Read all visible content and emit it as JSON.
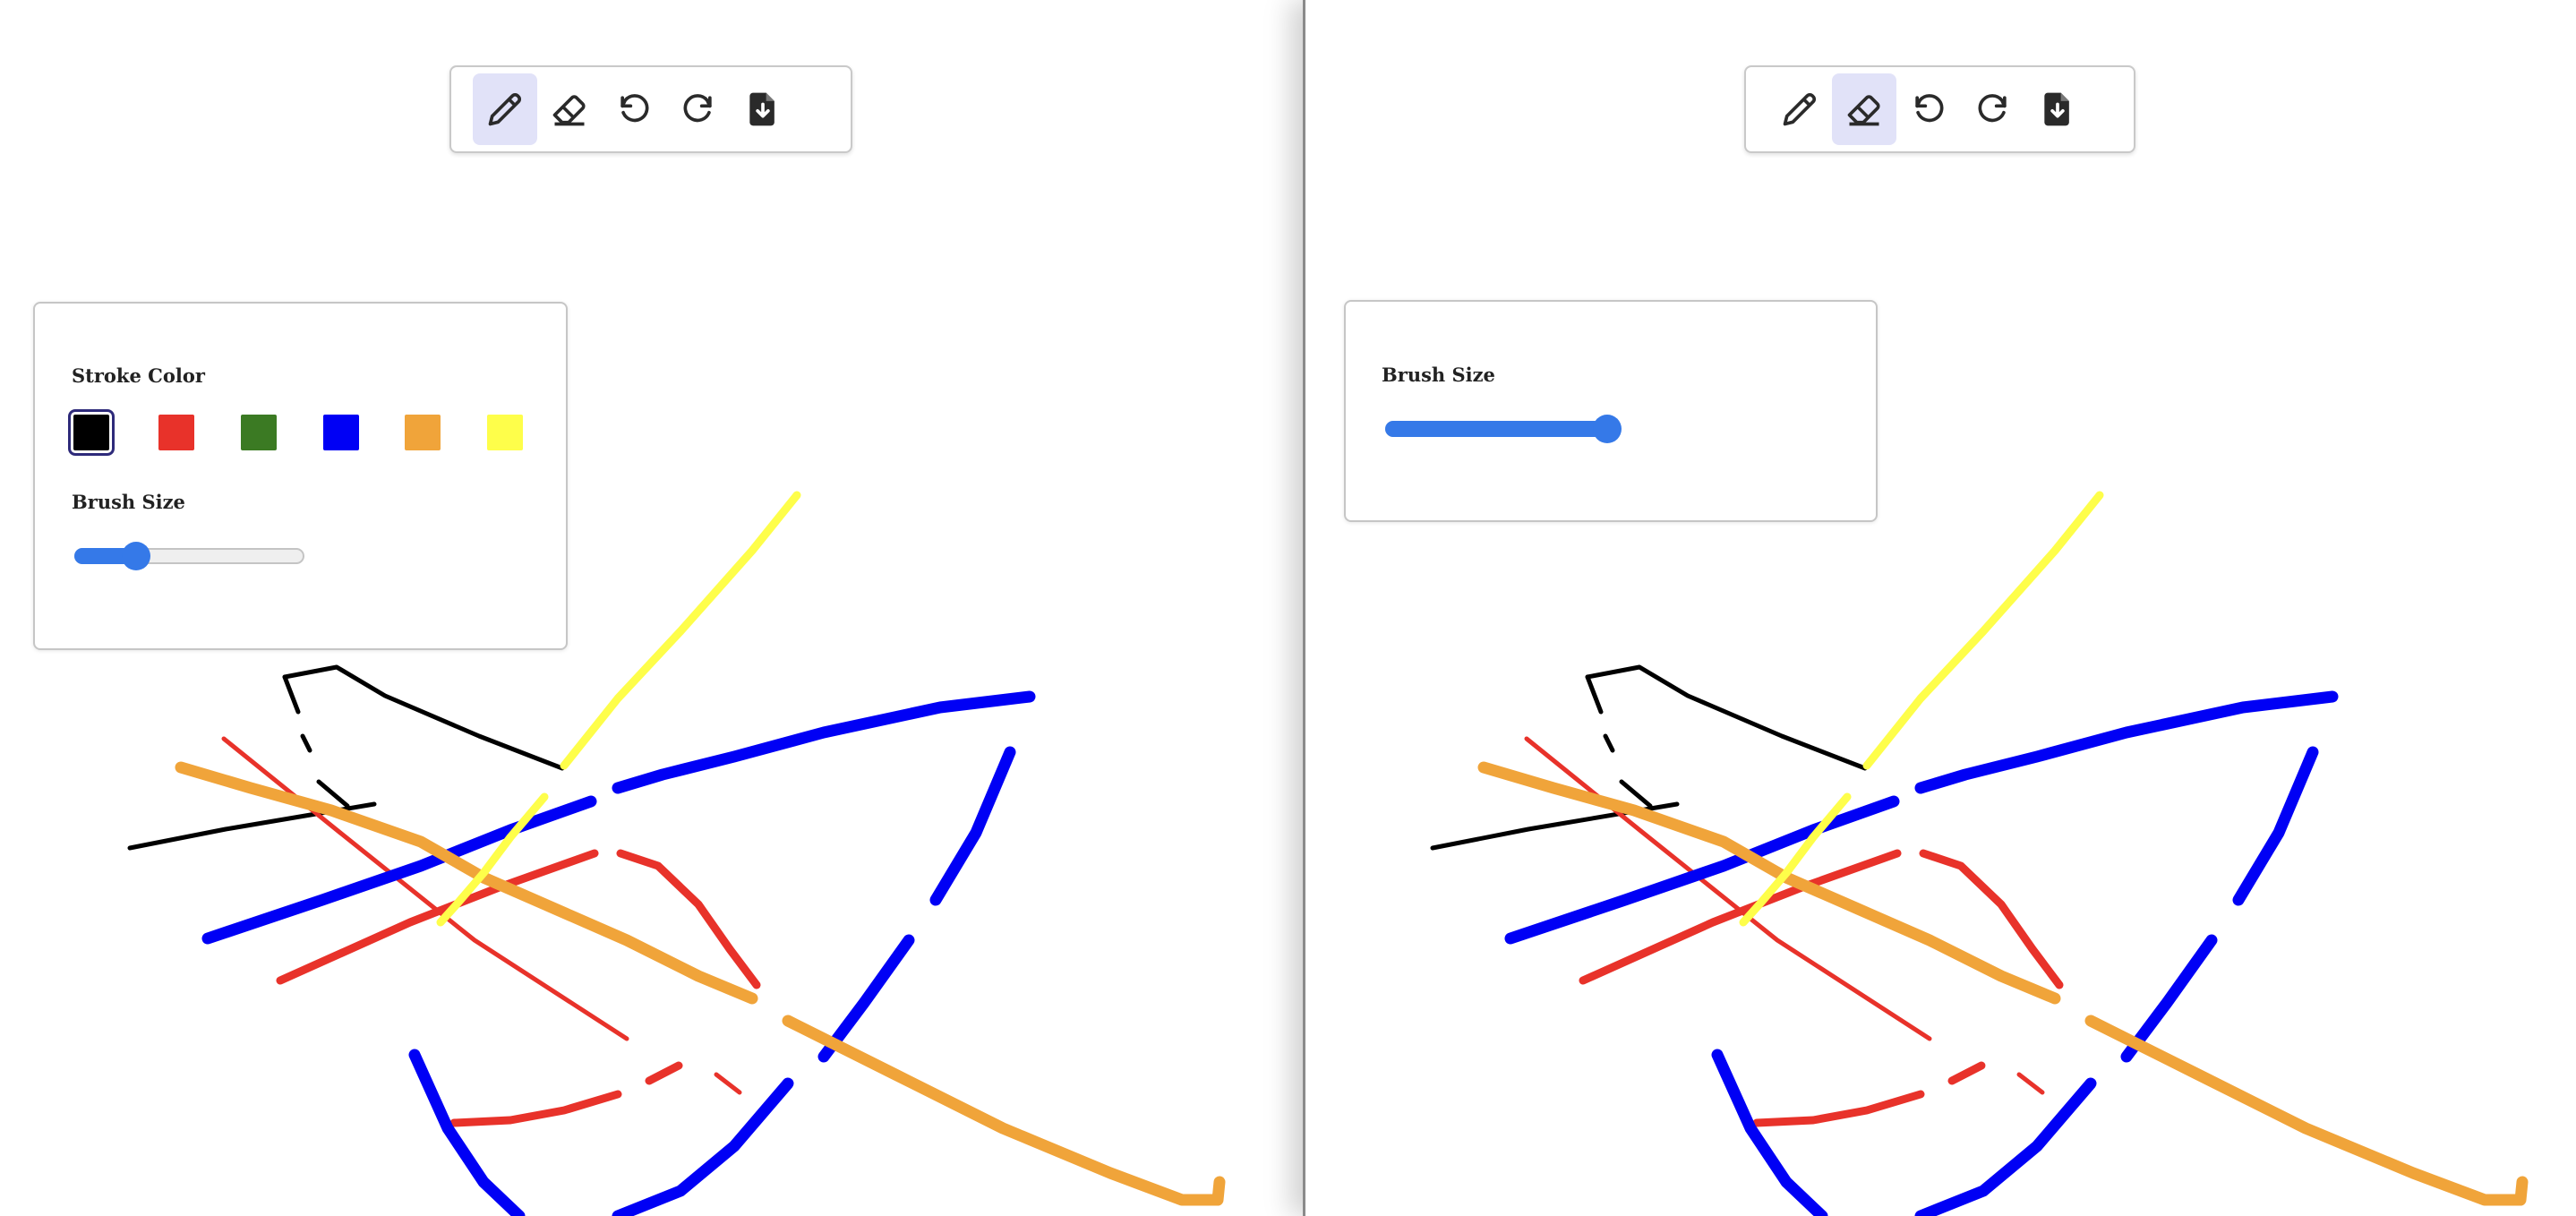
{
  "toolbar": {
    "tools": [
      {
        "name": "pencil",
        "icon": "pencil-icon"
      },
      {
        "name": "eraser",
        "icon": "eraser-icon"
      },
      {
        "name": "undo",
        "icon": "undo-icon"
      },
      {
        "name": "redo",
        "icon": "redo-icon"
      },
      {
        "name": "save",
        "icon": "file-download-icon"
      }
    ]
  },
  "left": {
    "active_tool": "pencil",
    "panel": {
      "stroke_color_label": "Stroke Color",
      "colors": [
        "#000000",
        "#e8322a",
        "#3b7a23",
        "#0000f5",
        "#f0a43a",
        "#fefe4a"
      ],
      "selected_color": "#000000",
      "brush_size_label": "Brush Size",
      "brush_size_fraction": 0.25
    }
  },
  "right": {
    "active_tool": "eraser",
    "panel": {
      "brush_size_label": "Brush Size",
      "brush_size_fraction": 1.0
    }
  },
  "stroke_colors": {
    "black": "#000000",
    "red": "#e8322a",
    "blue": "#0000f5",
    "orange": "#f0a43a",
    "yellow": "#fefe4a"
  }
}
